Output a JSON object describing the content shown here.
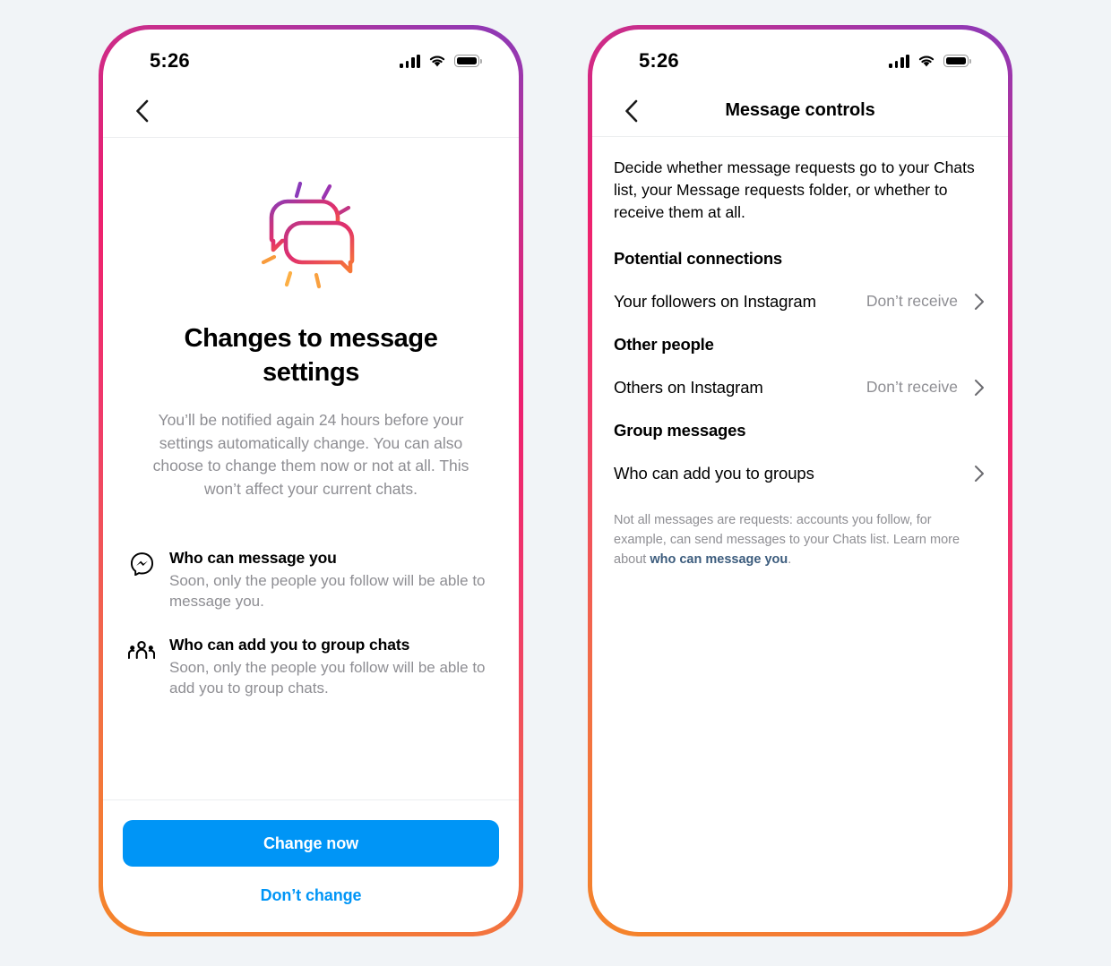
{
  "background_color": "#f1f4f7",
  "accent": {
    "primary_blue": "#0095f6",
    "muted_gray": "#8e8e93",
    "link_blue": "#3c5c7d",
    "gradient_start": "#8a3ab9",
    "gradient_mid": "#ed1f6f",
    "gradient_end": "#f58529"
  },
  "left_phone": {
    "status_bar": {
      "time": "5:26",
      "signal_icon": "signal-bars-icon",
      "wifi_icon": "wifi-icon",
      "battery_icon": "battery-full-icon"
    },
    "nav": {
      "back_icon": "chevron-left-icon",
      "title": ""
    },
    "illustration": "overlapping-speech-bubbles-illustration",
    "title": "Changes to message settings",
    "subtitle": "You’ll be notified again 24 hours before your settings automatically change. You can also choose to change them now or not at all. This won’t affect your current chats.",
    "features": [
      {
        "icon": "messenger-logo-icon",
        "title": "Who can message you",
        "description": "Soon, only the people you follow will be able to message you."
      },
      {
        "icon": "group-people-icon",
        "title": "Who can add you to group chats",
        "description": "Soon, only the people you follow will be able to add you to group chats."
      }
    ],
    "primary_button": "Change now",
    "secondary_button": "Don’t change"
  },
  "right_phone": {
    "status_bar": {
      "time": "5:26",
      "signal_icon": "signal-bars-icon",
      "wifi_icon": "wifi-icon",
      "battery_icon": "battery-full-icon"
    },
    "nav": {
      "back_icon": "chevron-left-icon",
      "title": "Message controls"
    },
    "intro": "Decide whether message requests go to your Chats list, your Message requests folder, or whether to receive them at all.",
    "sections": [
      {
        "heading": "Potential connections",
        "rows": [
          {
            "label": "Your followers on Instagram",
            "value": "Don’t receive",
            "chevron": "chevron-right-icon"
          }
        ]
      },
      {
        "heading": "Other people",
        "rows": [
          {
            "label": "Others on Instagram",
            "value": "Don’t receive",
            "chevron": "chevron-right-icon"
          }
        ]
      },
      {
        "heading": "Group messages",
        "rows": [
          {
            "label": "Who can add you to groups",
            "value": "",
            "chevron": "chevron-right-icon"
          }
        ]
      }
    ],
    "footnote": {
      "text_before": "Not all messages are requests: accounts you follow, for example, can send messages to your Chats list. Learn more about ",
      "link_text": "who can message you",
      "text_after": "."
    }
  }
}
